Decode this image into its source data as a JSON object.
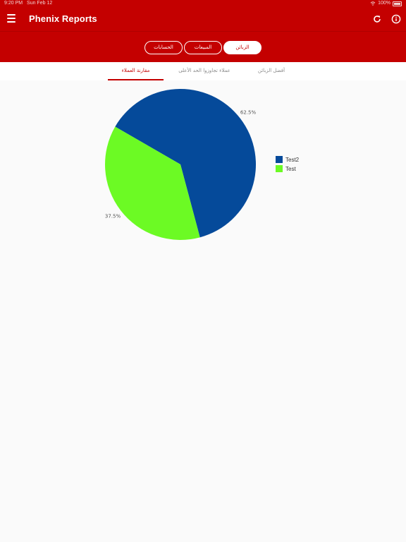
{
  "statusbar": {
    "time": "9:20 PM",
    "date": "Sun Feb 12",
    "battery": "100%"
  },
  "appbar": {
    "title": "Phenix Reports"
  },
  "segments": [
    {
      "label": "الزبائن",
      "active": true
    },
    {
      "label": "المبيعات",
      "active": false
    },
    {
      "label": "الحسابات",
      "active": false
    }
  ],
  "tabs": [
    {
      "label": "أفضل الزبائن",
      "active": false
    },
    {
      "label": "عملاء تجاوزوا الحد الأعلى",
      "active": false
    },
    {
      "label": "مقارنة العملاء",
      "active": true
    }
  ],
  "colors": {
    "primary": "#c40000",
    "test2": "#054a9a",
    "test": "#6cfa24"
  },
  "chart_data": {
    "type": "pie",
    "series": [
      {
        "name": "Test2",
        "value": 62.5,
        "label": "62.5%",
        "color": "#054a9a"
      },
      {
        "name": "Test",
        "value": 37.5,
        "label": "37.5%",
        "color": "#6cfa24"
      }
    ],
    "start_angle_deg": -150,
    "legend": "right"
  }
}
